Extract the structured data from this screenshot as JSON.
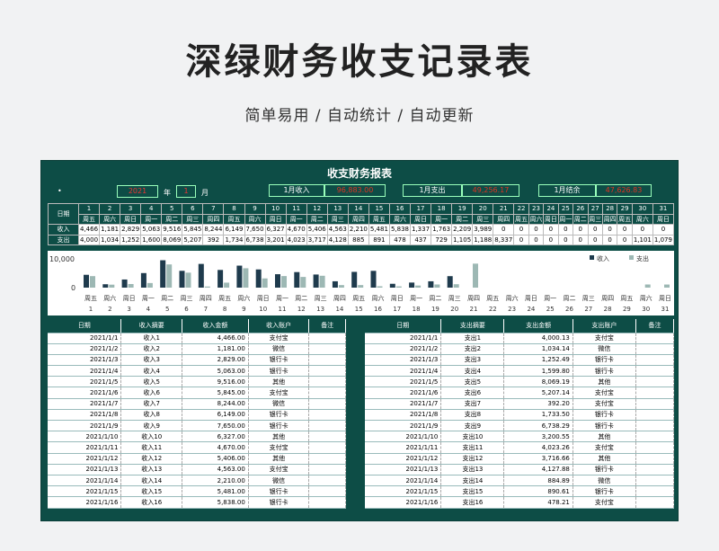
{
  "page": {
    "title": "深绿财务收支记录表",
    "subtitle": "简单易用 / 自动统计 / 自动更新"
  },
  "sheet": {
    "title": "收支财务报表",
    "year": "2021",
    "year_unit": "年",
    "month": "1",
    "month_unit": "月",
    "income_label": "1月收入",
    "expense_label": "1月支出",
    "balance_label": "1月结余",
    "income_value": "96,883.00",
    "expense_value": "49,256.17",
    "balance_value": "47,626.83"
  },
  "daily": {
    "row_label_date": "日期",
    "row_label_income": "收入",
    "row_label_expense": "支出",
    "days": [
      "1",
      "2",
      "3",
      "4",
      "5",
      "6",
      "7",
      "8",
      "9",
      "10",
      "11",
      "12",
      "13",
      "14",
      "15",
      "16",
      "17",
      "18",
      "19",
      "20",
      "21",
      "22",
      "23",
      "24",
      "25",
      "26",
      "27",
      "28",
      "29",
      "30",
      "31"
    ],
    "weekdays": [
      "周五",
      "周六",
      "周日",
      "周一",
      "周二",
      "周三",
      "周四",
      "周五",
      "周六",
      "周日",
      "周一",
      "周二",
      "周三",
      "周四",
      "周五",
      "周六",
      "周日",
      "周一",
      "周二",
      "周三",
      "周四",
      "周五",
      "周六",
      "周日",
      "周一",
      "周二",
      "周三",
      "周四",
      "周五",
      "周六",
      "周日"
    ],
    "income": [
      "4,466",
      "1,181",
      "2,829",
      "5,063",
      "9,516",
      "5,845",
      "8,244",
      "6,149",
      "7,650",
      "6,327",
      "4,670",
      "5,406",
      "4,563",
      "2,210",
      "5,481",
      "5,838",
      "1,337",
      "1,763",
      "2,209",
      "3,989",
      "0",
      "0",
      "0",
      "0",
      "0",
      "0",
      "0",
      "0",
      "0",
      "0",
      "0"
    ],
    "expense": [
      "4,000",
      "1,034",
      "1,252",
      "1,600",
      "8,069",
      "5,207",
      "392",
      "1,734",
      "6,738",
      "3,201",
      "4,023",
      "3,717",
      "4,128",
      "885",
      "891",
      "478",
      "437",
      "729",
      "1,105",
      "1,188",
      "8,337",
      "0",
      "0",
      "0",
      "0",
      "0",
      "0",
      "0",
      "0",
      "1,101",
      "1,079"
    ]
  },
  "chart_data": {
    "type": "bar",
    "ylim": [
      0,
      10000
    ],
    "ytick_labels": [
      "10,000",
      "0"
    ],
    "series": [
      {
        "name": "收入",
        "values": [
          4466,
          1181,
          2829,
          5063,
          9516,
          5845,
          8244,
          6149,
          7650,
          6327,
          4670,
          5406,
          4563,
          2210,
          5481,
          5838,
          1337,
          1763,
          2209,
          3989,
          0,
          0,
          0,
          0,
          0,
          0,
          0,
          0,
          0,
          0,
          0
        ]
      },
      {
        "name": "支出",
        "values": [
          4000,
          1034,
          1252,
          1600,
          8069,
          5207,
          392,
          1734,
          6738,
          3201,
          4023,
          3717,
          4128,
          885,
          891,
          478,
          437,
          729,
          1105,
          1188,
          8337,
          0,
          0,
          0,
          0,
          0,
          0,
          0,
          0,
          1101,
          1079
        ]
      }
    ],
    "colors": {
      "income": "#1f3b4d",
      "expense": "#9db8b4"
    }
  },
  "income_table": {
    "headers": [
      "日期",
      "收入摘要",
      "收入金额",
      "收入账户",
      "备注"
    ],
    "rows": [
      [
        "2021/1/1",
        "收入1",
        "4,466.00",
        "支付宝",
        ""
      ],
      [
        "2021/1/2",
        "收入2",
        "1,181.00",
        "微信",
        ""
      ],
      [
        "2021/1/3",
        "收入3",
        "2,829.00",
        "银行卡",
        ""
      ],
      [
        "2021/1/4",
        "收入4",
        "5,063.00",
        "银行卡",
        ""
      ],
      [
        "2021/1/5",
        "收入5",
        "9,516.00",
        "其他",
        ""
      ],
      [
        "2021/1/6",
        "收入6",
        "5,845.00",
        "支付宝",
        ""
      ],
      [
        "2021/1/7",
        "收入7",
        "8,244.00",
        "微信",
        ""
      ],
      [
        "2021/1/8",
        "收入8",
        "6,149.00",
        "银行卡",
        ""
      ],
      [
        "2021/1/9",
        "收入9",
        "7,650.00",
        "银行卡",
        ""
      ],
      [
        "2021/1/10",
        "收入10",
        "6,327.00",
        "其他",
        ""
      ],
      [
        "2021/1/11",
        "收入11",
        "4,670.00",
        "支付宝",
        ""
      ],
      [
        "2021/1/12",
        "收入12",
        "5,406.00",
        "其他",
        ""
      ],
      [
        "2021/1/13",
        "收入13",
        "4,563.00",
        "支付宝",
        ""
      ],
      [
        "2021/1/14",
        "收入14",
        "2,210.00",
        "微信",
        ""
      ],
      [
        "2021/1/15",
        "收入15",
        "5,481.00",
        "银行卡",
        ""
      ],
      [
        "2021/1/16",
        "收入16",
        "5,838.00",
        "银行卡",
        ""
      ]
    ]
  },
  "expense_table": {
    "headers": [
      "日期",
      "支出摘要",
      "支出金额",
      "支出账户",
      "备注"
    ],
    "rows": [
      [
        "2021/1/1",
        "支出1",
        "4,000.13",
        "支付宝",
        ""
      ],
      [
        "2021/1/2",
        "支出2",
        "1,034.14",
        "微信",
        ""
      ],
      [
        "2021/1/3",
        "支出3",
        "1,252.49",
        "银行卡",
        ""
      ],
      [
        "2021/1/4",
        "支出4",
        "1,599.80",
        "银行卡",
        ""
      ],
      [
        "2021/1/5",
        "支出5",
        "8,069.19",
        "其他",
        ""
      ],
      [
        "2021/1/6",
        "支出6",
        "5,207.14",
        "支付宝",
        ""
      ],
      [
        "2021/1/7",
        "支出7",
        "392.20",
        "支付宝",
        ""
      ],
      [
        "2021/1/8",
        "支出8",
        "1,733.50",
        "银行卡",
        ""
      ],
      [
        "2021/1/9",
        "支出9",
        "6,738.29",
        "银行卡",
        ""
      ],
      [
        "2021/1/10",
        "支出10",
        "3,200.55",
        "其他",
        ""
      ],
      [
        "2021/1/11",
        "支出11",
        "4,023.26",
        "支付宝",
        ""
      ],
      [
        "2021/1/12",
        "支出12",
        "3,716.66",
        "其他",
        ""
      ],
      [
        "2021/1/13",
        "支出13",
        "4,127.88",
        "银行卡",
        ""
      ],
      [
        "2021/1/14",
        "支出14",
        "884.89",
        "微信",
        ""
      ],
      [
        "2021/1/15",
        "支出15",
        "890.61",
        "银行卡",
        ""
      ],
      [
        "2021/1/16",
        "支出16",
        "478.21",
        "支付宝",
        ""
      ]
    ]
  }
}
